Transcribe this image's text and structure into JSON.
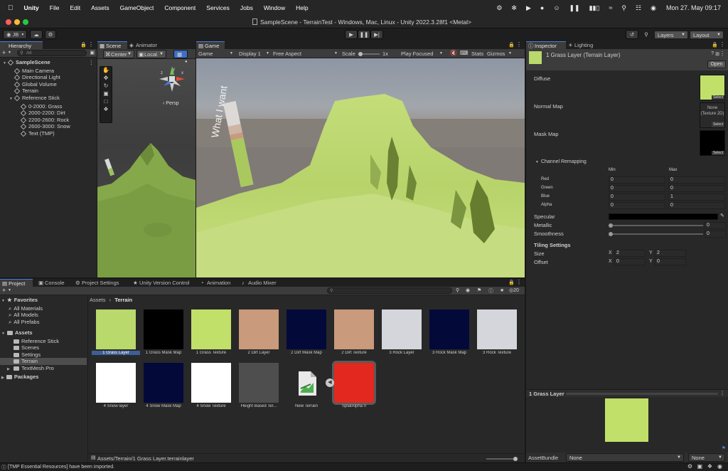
{
  "menubar": {
    "apple": "",
    "items": [
      "Unity",
      "File",
      "Edit",
      "Assets",
      "GameObject",
      "Component",
      "Services",
      "Jobs",
      "Window",
      "Help"
    ],
    "datetime": "Mon 27. May  09:17"
  },
  "window": {
    "title": "SampleScene - TerrainTest - Windows, Mac, Linux - Unity 2022.3.28f1 <Metal>"
  },
  "toolbar": {
    "account": "JB",
    "layers": "Layers",
    "layout": "Layout"
  },
  "hierarchy": {
    "tab": "Hierarchy",
    "search_placeholder": "All",
    "items": [
      {
        "label": "SampleScene",
        "depth": 0,
        "kind": "scene"
      },
      {
        "label": "Main Camera",
        "depth": 1,
        "kind": "object"
      },
      {
        "label": "Directional Light",
        "depth": 1,
        "kind": "object"
      },
      {
        "label": "Global Volume",
        "depth": 1,
        "kind": "object"
      },
      {
        "label": "Terrain",
        "depth": 1,
        "kind": "object"
      },
      {
        "label": "Reference Stick",
        "depth": 1,
        "kind": "parent"
      },
      {
        "label": "0-2000: Grass",
        "depth": 2,
        "kind": "object"
      },
      {
        "label": "2000-2200: Dirt",
        "depth": 2,
        "kind": "object"
      },
      {
        "label": "2200-2600: Rock",
        "depth": 2,
        "kind": "object"
      },
      {
        "label": "2600-3000: Snow",
        "depth": 2,
        "kind": "object"
      },
      {
        "label": "Text (TMP)",
        "depth": 2,
        "kind": "object"
      }
    ]
  },
  "scene": {
    "tabs": [
      "Scene",
      "Animator"
    ],
    "pivot": "Center",
    "space": "Local",
    "persp": "Persp",
    "gizmo_axes": {
      "x": "x",
      "y": "y",
      "z": "z"
    }
  },
  "game": {
    "tab": "Game",
    "mode": "Game",
    "display": "Display 1",
    "aspect": "Free Aspect",
    "scale_label": "Scale",
    "scale_value": "1x",
    "play_mode": "Play Focused",
    "stats": "Stats",
    "gizmos": "Gizmos",
    "stick_text": "What I want"
  },
  "inspector": {
    "tabs": [
      "Inspector",
      "Lighting"
    ],
    "asset_name": "1 Grass Layer (Terrain Layer)",
    "open_button": "Open",
    "diffuse": "Diffuse",
    "normal_map": "Normal Map",
    "normal_none": "None",
    "normal_type": "(Texture 2D)",
    "mask_map": "Mask Map",
    "select": "Select",
    "channel_remapping": "Channel Remapping",
    "min_label": "Min",
    "max_label": "Max",
    "channels": [
      {
        "name": "Red",
        "min": "0",
        "max": "0"
      },
      {
        "name": "Green",
        "min": "0",
        "max": "0"
      },
      {
        "name": "Blue",
        "min": "0",
        "max": "1"
      },
      {
        "name": "Alpha",
        "min": "0",
        "max": "0"
      }
    ],
    "specular": "Specular",
    "metallic": "Metallic",
    "metallic_value": "0",
    "smoothness": "Smoothness",
    "smoothness_value": "0",
    "tiling_settings": "Tiling Settings",
    "size": "Size",
    "size_x": "2",
    "size_y": "2",
    "offset": "Offset",
    "offset_x": "0",
    "offset_y": "0",
    "x_label": "X",
    "y_label": "Y",
    "preview_title": "1 Grass Layer",
    "assetbundle": "AssetBundle",
    "assetbundle_value": "None",
    "assetbundle_variant": "None"
  },
  "bottom_tabs": [
    "Project",
    "Console",
    "Project Settings",
    "Unity Version Control",
    "Animation",
    "Audio Mixer"
  ],
  "project": {
    "favorites": "Favorites",
    "favorites_items": [
      "All Materials",
      "All Models",
      "All Prefabs"
    ],
    "assets": "Assets",
    "asset_folders": [
      "Reference Stick",
      "Scenes",
      "Settings",
      "Terrain",
      "TextMesh Pro"
    ],
    "packages": "Packages",
    "breadcrumb": [
      "Assets",
      "Terrain"
    ],
    "hidden_count": "20",
    "items": [
      {
        "label": "1 Grass Layer",
        "color": "#b9d96d"
      },
      {
        "label": "1 Grass Mask Map",
        "color": "#000000"
      },
      {
        "label": "1 Grass Texture",
        "color": "#c1e06a"
      },
      {
        "label": "2 Dirt Layer",
        "color": "#c99a7c"
      },
      {
        "label": "2 Dirt Mask Map",
        "color": "#030a3a"
      },
      {
        "label": "2 Dirt Texture",
        "color": "#c99a7c"
      },
      {
        "label": "3 Rock Layer",
        "color": "#d5d6dc"
      },
      {
        "label": "3 Rock Mask Map",
        "color": "#030a3a"
      },
      {
        "label": "3 Rock Texture",
        "color": "#d5d6dc"
      },
      {
        "label": "4 Snow layer",
        "color": "#ffffff"
      },
      {
        "label": "4 Snow Mask Map",
        "color": "#030a3a"
      },
      {
        "label": "4 Snow Texture",
        "color": "#ffffff"
      },
      {
        "label": "Height Based Ter...",
        "color": "#4e4e4e"
      },
      {
        "label": "New Terrain",
        "color": "#2b2b2b"
      },
      {
        "label": "SplatAlpha 0",
        "color": "#e2281f"
      }
    ],
    "path": "Assets/Terrain/1 Grass Layer.terrainlayer"
  },
  "statusbar": {
    "message": "[TMP Essential Resources] have been imported."
  },
  "colors": {
    "accent": "#4b7bd6",
    "grass": "#bcdb6d",
    "panel": "#282828"
  }
}
